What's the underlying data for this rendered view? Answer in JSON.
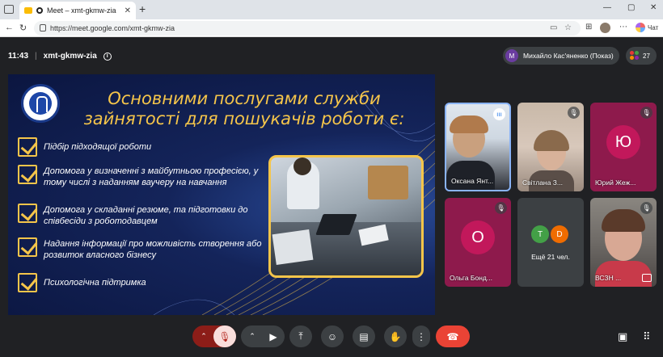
{
  "browser": {
    "tab_title": "Meet – xmt-gkmw-zia",
    "tab_close": "✕",
    "new_tab": "+",
    "window_controls": [
      "—",
      "▢",
      "✕"
    ],
    "url": "https://meet.google.com/xmt-gkmw-zia",
    "chat_label": "Чат"
  },
  "meeting": {
    "time": "11:43",
    "separator": "|",
    "code": "xmt-gkmw-zia",
    "presenter_initial": "M",
    "presenter_label": "Михайло Кас'яненко (Показ)",
    "participant_count": "27"
  },
  "slide": {
    "title": "Основними послугами служби зайнятості для пошукачів роботи є:",
    "bullets": [
      "Підбір підходящої роботи",
      "Допомога у визначенні з майбутньою професією, у тому числі з наданням ваучеру на навчання",
      "Допомога у складанні резюме, та підготовки до співбесіди з роботодавцем",
      "Надання інформації про можливість створення або розвиток власного бізнесу",
      "Психологічна підтримка"
    ]
  },
  "participants": [
    {
      "name": "Оксана Янт...",
      "kind": "video"
    },
    {
      "name": "Світлана З...",
      "kind": "video"
    },
    {
      "name": "Юрий Жеж...",
      "kind": "avatar",
      "initial": "Ю",
      "color": "#c2185b",
      "bg": "#8e1a4c"
    },
    {
      "name": "Ольга Бонд...",
      "kind": "avatar",
      "initial": "О",
      "color": "#c2185b",
      "bg": "#8e1a4c"
    },
    {
      "name": "Ещё 21 чел.",
      "kind": "group",
      "initials": [
        "T",
        "D"
      ],
      "colors": [
        "#43a047",
        "#ef6c00"
      ]
    },
    {
      "name": "ВСЗН ...",
      "kind": "video"
    }
  ],
  "colors": {
    "accent_gold": "#f5c54a",
    "end_call": "#ea4335",
    "mic_off_bg": "#f9dedc"
  }
}
